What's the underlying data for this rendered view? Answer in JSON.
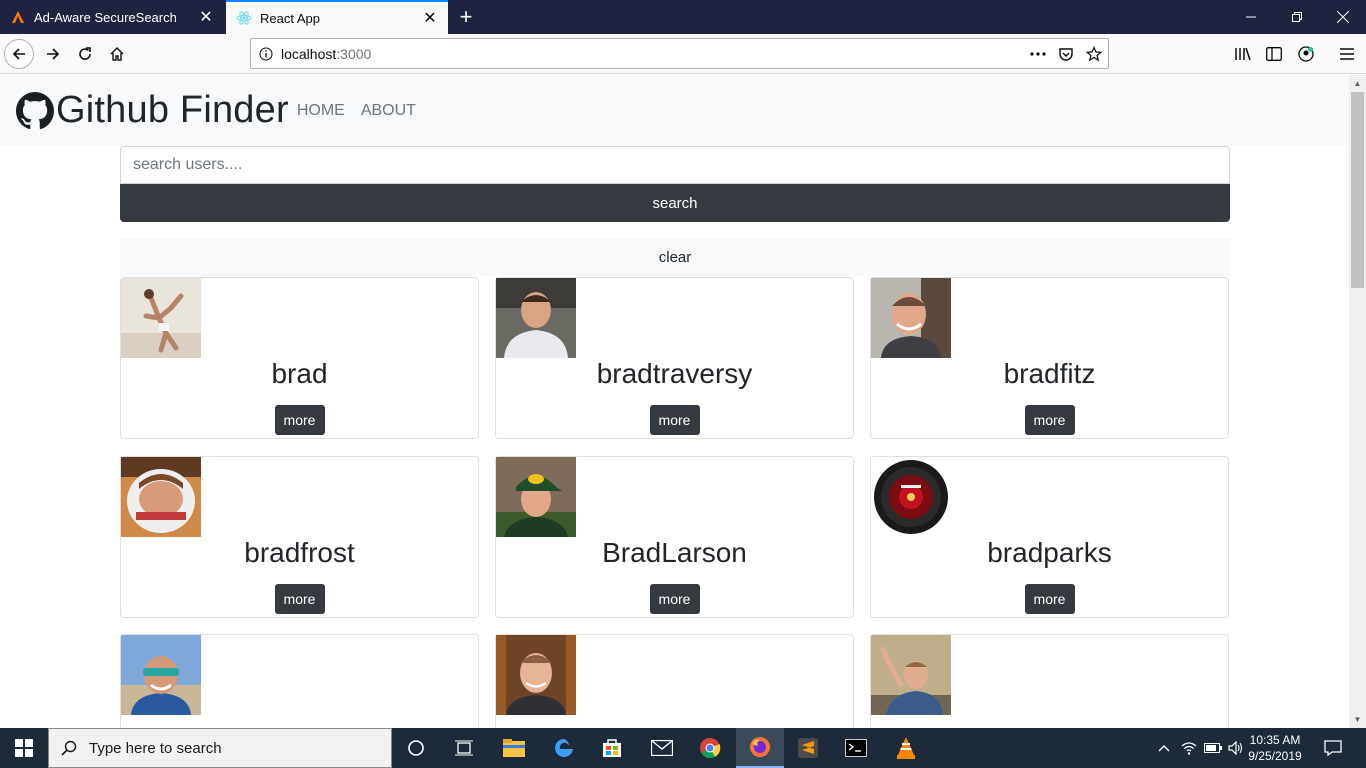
{
  "browser": {
    "tabs": [
      {
        "title": "Ad-Aware SecureSearch",
        "icon": "adaware-icon",
        "active": false
      },
      {
        "title": "React App",
        "icon": "react-icon",
        "active": true
      }
    ],
    "url_host": "localhost",
    "url_port": ":3000"
  },
  "navbar": {
    "brand": "Github Finder",
    "links": [
      "HOME",
      "ABOUT"
    ]
  },
  "search": {
    "placeholder": "search users....",
    "button_label": "search",
    "clear_label": "clear"
  },
  "users": [
    {
      "login": "brad",
      "more_label": "more"
    },
    {
      "login": "bradtraversy",
      "more_label": "more"
    },
    {
      "login": "bradfitz",
      "more_label": "more"
    },
    {
      "login": "bradfrost",
      "more_label": "more"
    },
    {
      "login": "BradLarson",
      "more_label": "more"
    },
    {
      "login": "bradparks",
      "more_label": "more"
    }
  ],
  "taskbar": {
    "search_placeholder": "Type here to search",
    "time": "10:35 AM",
    "date": "9/25/2019"
  },
  "colors": {
    "tab_bar": "#202340",
    "accent": "#0a84ff",
    "dark_button": "#343a40",
    "navbar_bg": "#f8f9fa"
  }
}
